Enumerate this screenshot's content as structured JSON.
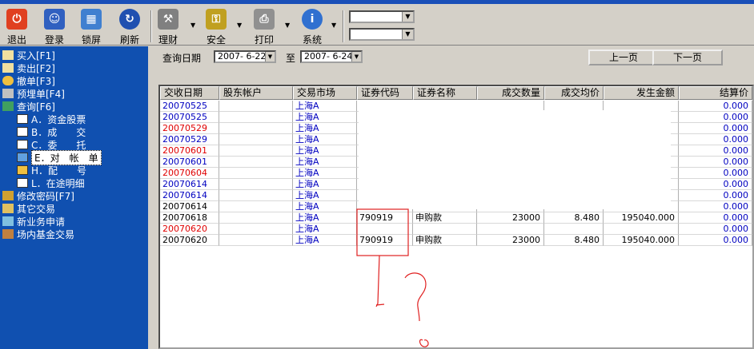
{
  "toolbar": {
    "buttons": [
      {
        "label": "退出",
        "icon": "power-icon",
        "color": "#e04020"
      },
      {
        "label": "登录",
        "icon": "users-icon",
        "color": "#3060c0"
      },
      {
        "label": "锁屏",
        "icon": "lock-screen-icon",
        "color": "#4080d0"
      },
      {
        "label": "刷新",
        "icon": "refresh-icon",
        "color": "#2050b0"
      },
      {
        "label": "理财",
        "icon": "tools-icon",
        "color": "#808080"
      },
      {
        "label": "安全",
        "icon": "key-icon",
        "color": "#c0a020"
      },
      {
        "label": "打印",
        "icon": "printer-icon",
        "color": "#909090"
      },
      {
        "label": "系统",
        "icon": "info-icon",
        "color": "#3070d0"
      }
    ]
  },
  "sidebar": {
    "items": [
      {
        "label": "买入[F1]"
      },
      {
        "label": "卖出[F2]"
      },
      {
        "label": "撤单[F3]"
      },
      {
        "label": "预埋单[F4]"
      },
      {
        "label": "查询[F6]"
      },
      {
        "label": "A．资金股票"
      },
      {
        "label": "B．成　　交"
      },
      {
        "label": "C．委　　托"
      },
      {
        "label": "E．对　帐　单"
      },
      {
        "label": "H．配　　号"
      },
      {
        "label": "L．在途明细"
      },
      {
        "label": "修改密码[F7]"
      },
      {
        "label": "其它交易"
      },
      {
        "label": "新业务申请"
      },
      {
        "label": "场内基金交易"
      }
    ]
  },
  "query": {
    "date_label": "查询日期",
    "from": "2007- 6-22",
    "to_label": "至",
    "to": "2007- 6-24",
    "prev_page": "上一页",
    "next_page": "下一页"
  },
  "table": {
    "headers": [
      "交收日期",
      "股东帐户",
      "交易市场",
      "证券代码",
      "证券名称",
      "成交数量",
      "成交均价",
      "发生金额",
      "结算价"
    ],
    "rows": [
      {
        "date": "20070525",
        "market": "上海A",
        "code": "",
        "name": "",
        "qty": "",
        "price": "",
        "amount": "",
        "settle": "0.000",
        "color": "blue"
      },
      {
        "date": "20070525",
        "market": "上海A",
        "code": "",
        "name": "",
        "qty": "",
        "price": "",
        "amount": "",
        "settle": "0.000",
        "color": "blue"
      },
      {
        "date": "20070529",
        "market": "上海A",
        "code": "",
        "name": "",
        "qty": "",
        "price": "",
        "amount": "",
        "settle": "0.000",
        "color": "red"
      },
      {
        "date": "20070529",
        "market": "上海A",
        "code": "",
        "name": "",
        "qty": "",
        "price": "",
        "amount": "",
        "settle": "0.000",
        "color": "blue"
      },
      {
        "date": "20070601",
        "market": "上海A",
        "code": "",
        "name": "",
        "qty": "",
        "price": "",
        "amount": "",
        "settle": "0.000",
        "color": "red"
      },
      {
        "date": "20070601",
        "market": "上海A",
        "code": "",
        "name": "",
        "qty": "",
        "price": "",
        "amount": "",
        "settle": "0.000",
        "color": "blue"
      },
      {
        "date": "20070604",
        "market": "上海A",
        "code": "",
        "name": "",
        "qty": "",
        "price": "",
        "amount": "",
        "settle": "0.000",
        "color": "red"
      },
      {
        "date": "20070614",
        "market": "上海A",
        "code": "",
        "name": "",
        "qty": "",
        "price": "",
        "amount": "",
        "settle": "0.000",
        "color": "blue"
      },
      {
        "date": "20070614",
        "market": "上海A",
        "code": "",
        "name": "",
        "qty": "",
        "price": "",
        "amount": "",
        "settle": "0.000",
        "color": "blue"
      },
      {
        "date": "20070614",
        "market": "上海A",
        "code": "",
        "name": "",
        "qty": "",
        "price": "",
        "amount": "",
        "settle": "0.000",
        "color": "black"
      },
      {
        "date": "20070618",
        "market": "上海A",
        "code": "790919",
        "name": "申购款",
        "qty": "23000",
        "price": "8.480",
        "amount": "195040.000",
        "settle": "0.000",
        "color": "black"
      },
      {
        "date": "20070620",
        "market": "上海A",
        "code": "",
        "name": "",
        "qty": "",
        "price": "",
        "amount": "",
        "settle": "0.000",
        "color": "red"
      },
      {
        "date": "20070620",
        "market": "上海A",
        "code": "790919",
        "name": "申购款",
        "qty": "23000",
        "price": "8.480",
        "amount": "195040.000",
        "settle": "0.000",
        "color": "black"
      }
    ]
  },
  "colors": {
    "sidebar_bg": "#1050b0",
    "red_text": "#e00000",
    "blue_text": "#0000c0",
    "annotation": "#e02020"
  }
}
